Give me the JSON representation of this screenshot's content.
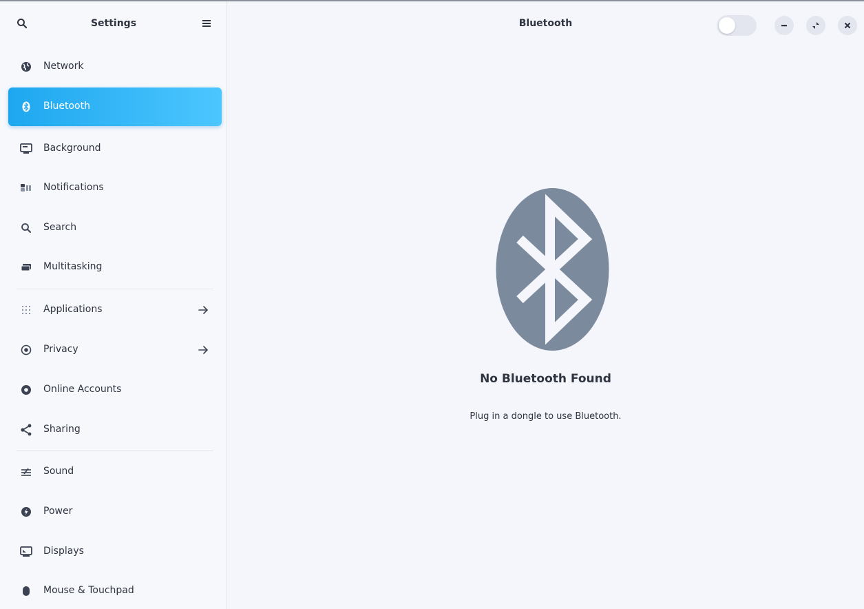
{
  "sidebar": {
    "title": "Settings",
    "header_icons": [
      "search-icon",
      "hamburger-menu-icon"
    ],
    "items": [
      {
        "label": "Network",
        "icon": "globe-icon"
      },
      {
        "label": "Bluetooth",
        "icon": "bluetooth-icon",
        "active": true
      },
      {
        "label": "Background",
        "icon": "monitor-icon"
      },
      {
        "label": "Notifications",
        "icon": "notifications-icon"
      },
      {
        "label": "Search",
        "icon": "search-icon"
      },
      {
        "label": "Multitasking",
        "icon": "multitasking-icon"
      },
      {
        "label": "Applications",
        "icon": "grid-icon",
        "has_arrow": true
      },
      {
        "label": "Privacy",
        "icon": "privacy-icon",
        "has_arrow": true
      },
      {
        "label": "Online Accounts",
        "icon": "accounts-icon"
      },
      {
        "label": "Sharing",
        "icon": "share-icon"
      },
      {
        "label": "Sound",
        "icon": "sound-icon"
      },
      {
        "label": "Power",
        "icon": "power-icon"
      },
      {
        "label": "Displays",
        "icon": "display-icon"
      },
      {
        "label": "Mouse & Touchpad",
        "icon": "mouse-icon"
      }
    ]
  },
  "main": {
    "title": "Bluetooth",
    "bluetooth_toggle": "off",
    "empty_state": {
      "icon": "bluetooth-logo-icon",
      "title": "No Bluetooth Found",
      "subtitle": "Plug in a dongle to use Bluetooth."
    }
  },
  "window_controls": [
    "minimize-icon",
    "restore-icon",
    "close-icon"
  ],
  "colors": {
    "accent": "#1ea7ef",
    "background": "#f4f6fb",
    "icon": "#7b8a9c",
    "text": "#2e3440"
  }
}
